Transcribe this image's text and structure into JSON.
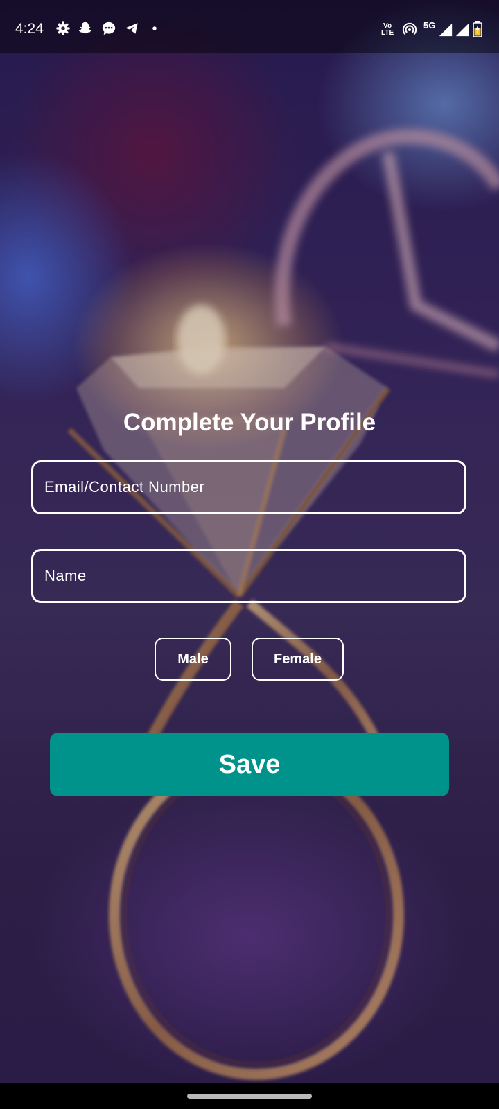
{
  "status_bar": {
    "time": "4:24",
    "left_icons": [
      "gear-icon",
      "snapchat-icon",
      "message-icon",
      "telegram-icon",
      "dot-icon"
    ],
    "volte_label_top": "Vo",
    "volte_label_bottom": "LTE",
    "network_label": "5G",
    "right_icons": [
      "hotspot-icon",
      "signal-icon",
      "signal-icon",
      "battery-charging-icon"
    ]
  },
  "form": {
    "title": "Complete Your Profile",
    "email_placeholder": "Email/Contact Number",
    "name_placeholder": "Name",
    "gender_options": [
      "Male",
      "Female"
    ],
    "save_label": "Save"
  },
  "colors": {
    "save_button": "#00938b",
    "field_border": "#ffffff",
    "text": "#ffffff"
  }
}
